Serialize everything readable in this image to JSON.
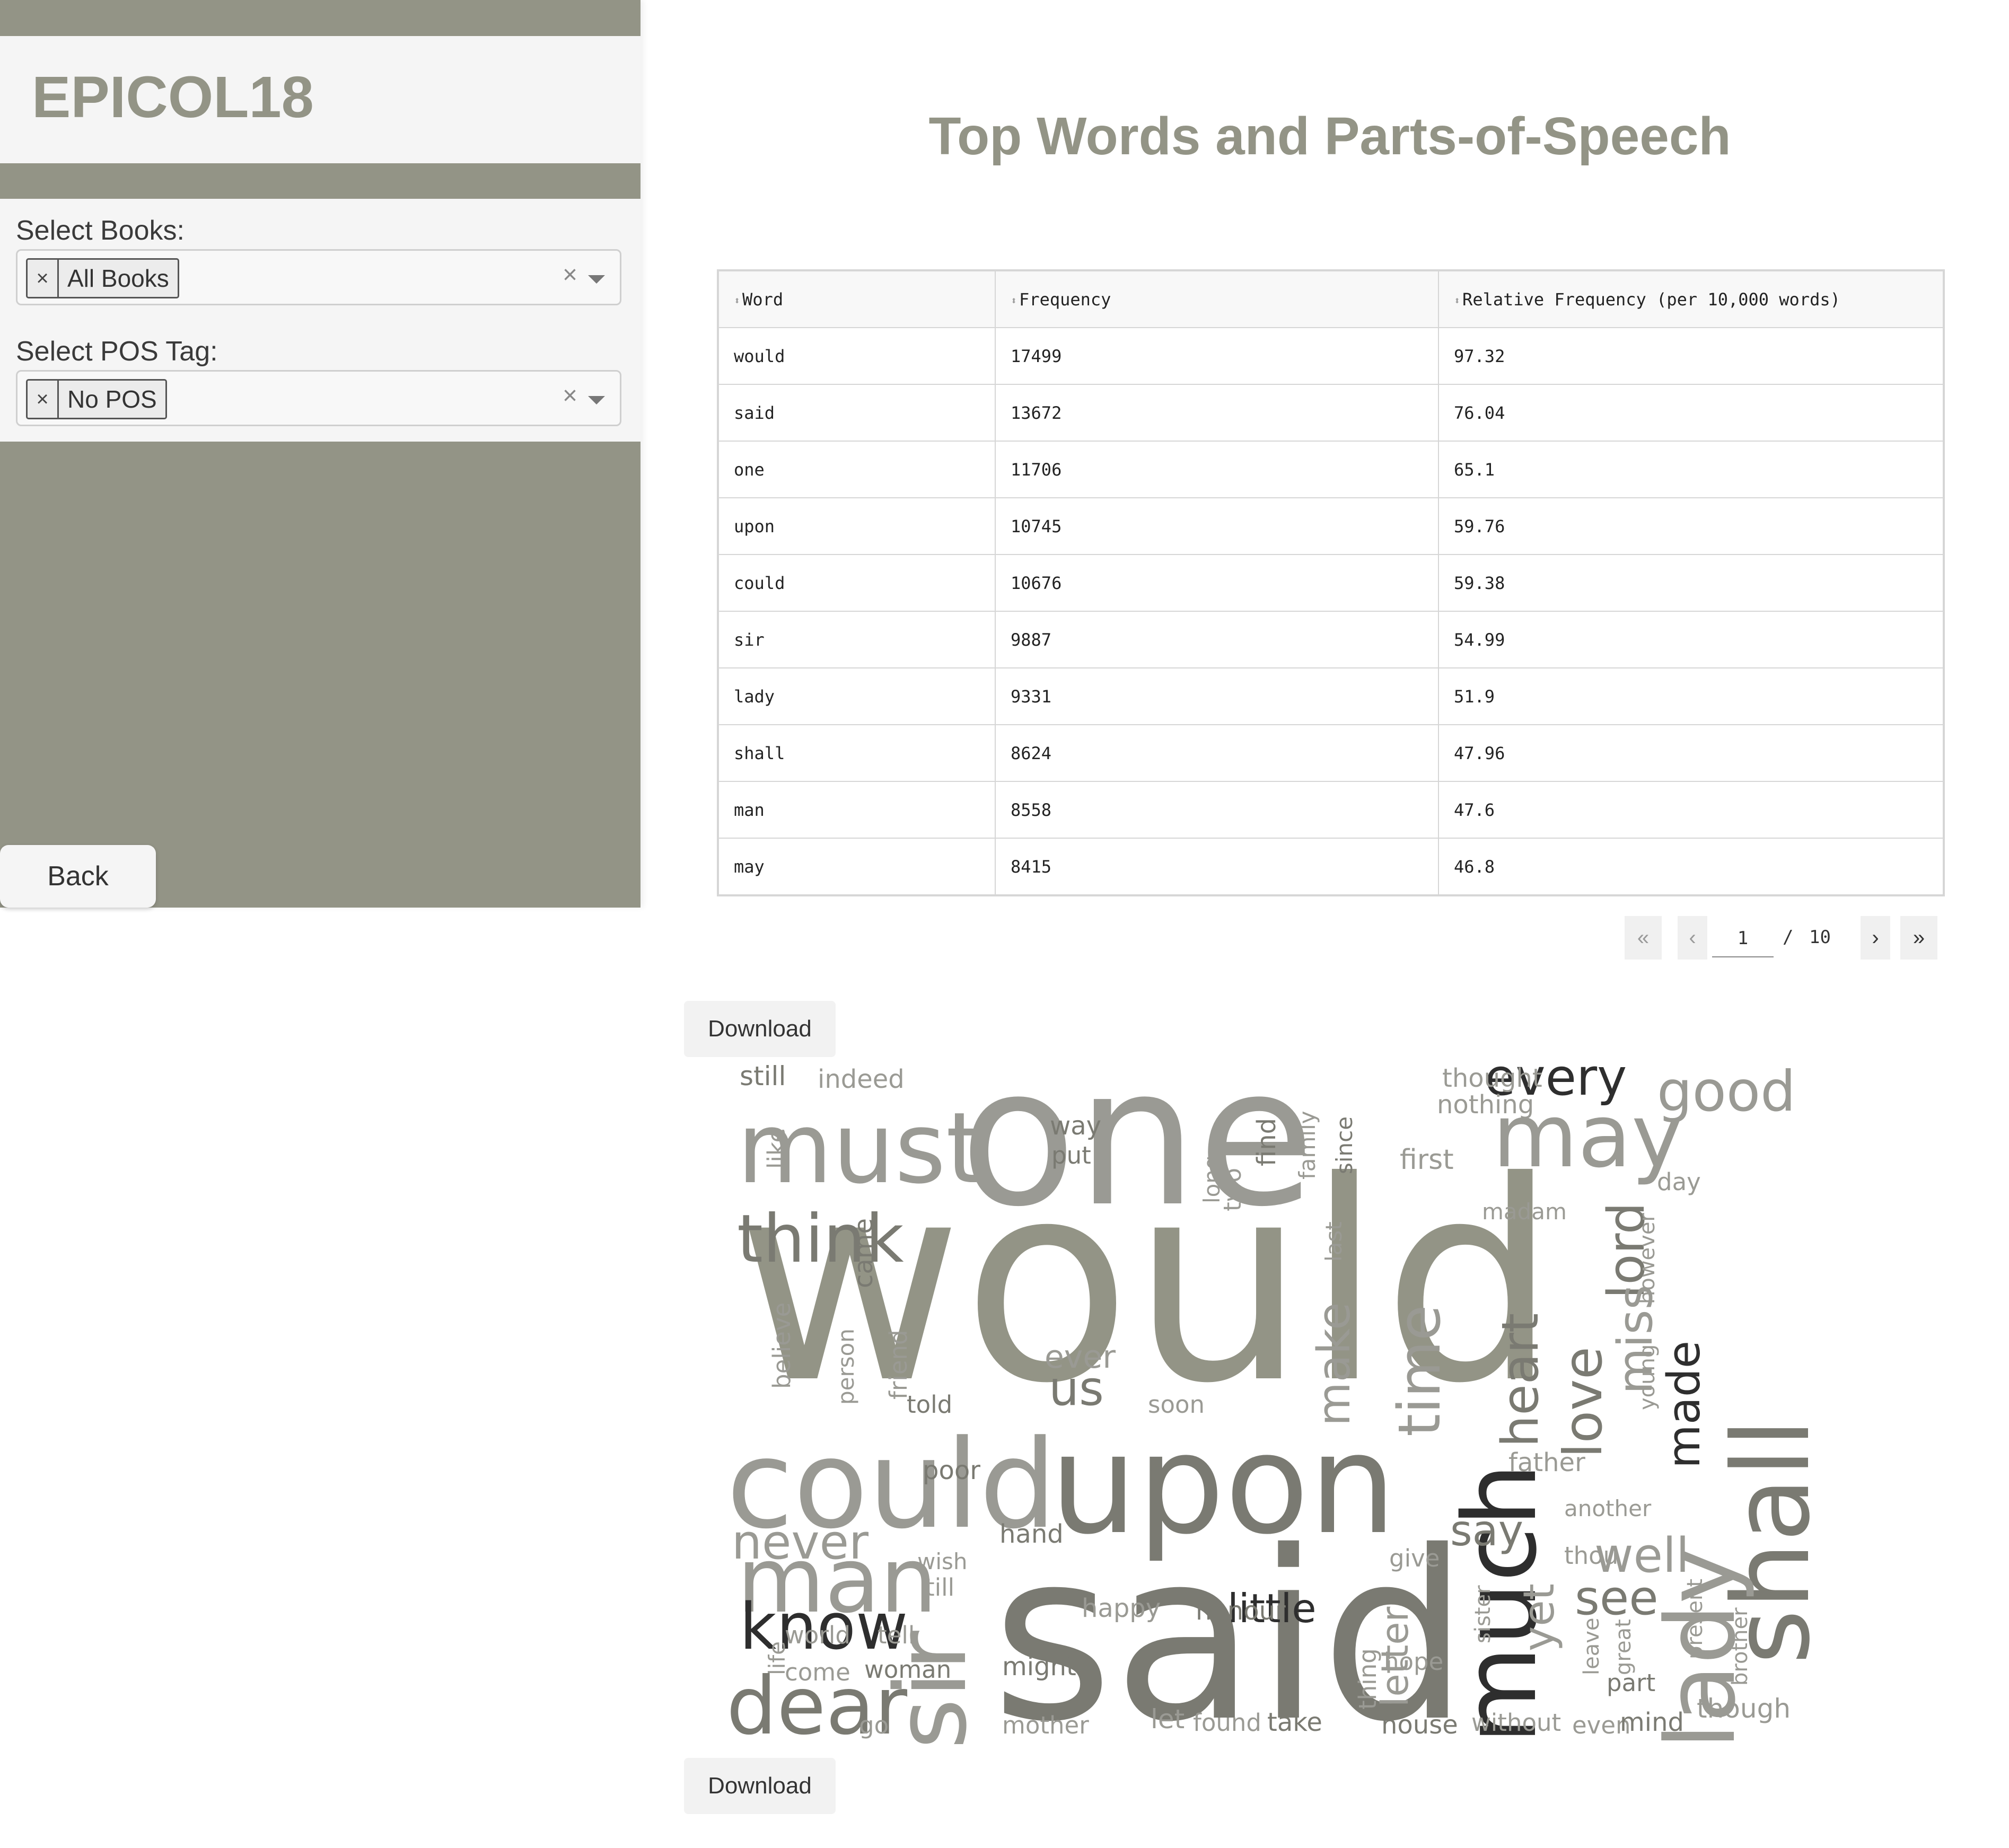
{
  "sidebar": {
    "brand": "EPICOL18",
    "books_label": "Select Books:",
    "books_selected": "All Books",
    "pos_label": "Select POS Tag:",
    "pos_selected": "No POS",
    "chip_remove": "×",
    "clear_icon": "×",
    "back_label": "Back"
  },
  "main": {
    "title": "Top Words and Parts-of-Speech",
    "table": {
      "columns": [
        "Word",
        "Frequency",
        "Relative Frequency (per 10,000 words)"
      ],
      "rows": [
        [
          "would",
          "17499",
          "97.32"
        ],
        [
          "said",
          "13672",
          "76.04"
        ],
        [
          "one",
          "11706",
          "65.1"
        ],
        [
          "upon",
          "10745",
          "59.76"
        ],
        [
          "could",
          "10676",
          "59.38"
        ],
        [
          "sir",
          "9887",
          "54.99"
        ],
        [
          "lady",
          "9331",
          "51.9"
        ],
        [
          "shall",
          "8624",
          "47.96"
        ],
        [
          "man",
          "8558",
          "47.6"
        ],
        [
          "may",
          "8415",
          "46.8"
        ]
      ]
    },
    "pagination": {
      "current": "1",
      "separator": "/",
      "total": "10"
    },
    "download_label_1": "Download",
    "download_label_2": "Download"
  },
  "wordcloud": {
    "colors": {
      "light": "#9a9a94",
      "mid": "#7a7a72",
      "dark": "#2e2e2e",
      "olive": "#939486"
    },
    "words": [
      "would",
      "said",
      "one",
      "upon",
      "could",
      "shall",
      "lady",
      "much",
      "must",
      "may",
      "sir",
      "man",
      "think",
      "dear",
      "know",
      "good",
      "every",
      "love",
      "made",
      "heart",
      "time",
      "lord",
      "miss",
      "never",
      "make",
      "us",
      "say",
      "see",
      "well",
      "little",
      "yet",
      "letter",
      "still",
      "indeed",
      "like",
      "thought",
      "nothing",
      "first",
      "madam",
      "day",
      "way",
      "put",
      "find",
      "family",
      "since",
      "two",
      "long",
      "came",
      "ever",
      "last",
      "however",
      "young",
      "believe",
      "friend",
      "person",
      "told",
      "soon",
      "poor",
      "father",
      "another",
      "hand",
      "wish",
      "till",
      "give",
      "thou",
      "happy",
      "honour",
      "world",
      "tell",
      "life",
      "come",
      "woman",
      "might",
      "go",
      "let",
      "found",
      "take",
      "house",
      "without",
      "even",
      "mind",
      "mother",
      "hope",
      "thing",
      "sister",
      "leave",
      "great",
      "part",
      "present",
      "brother",
      "though"
    ]
  }
}
